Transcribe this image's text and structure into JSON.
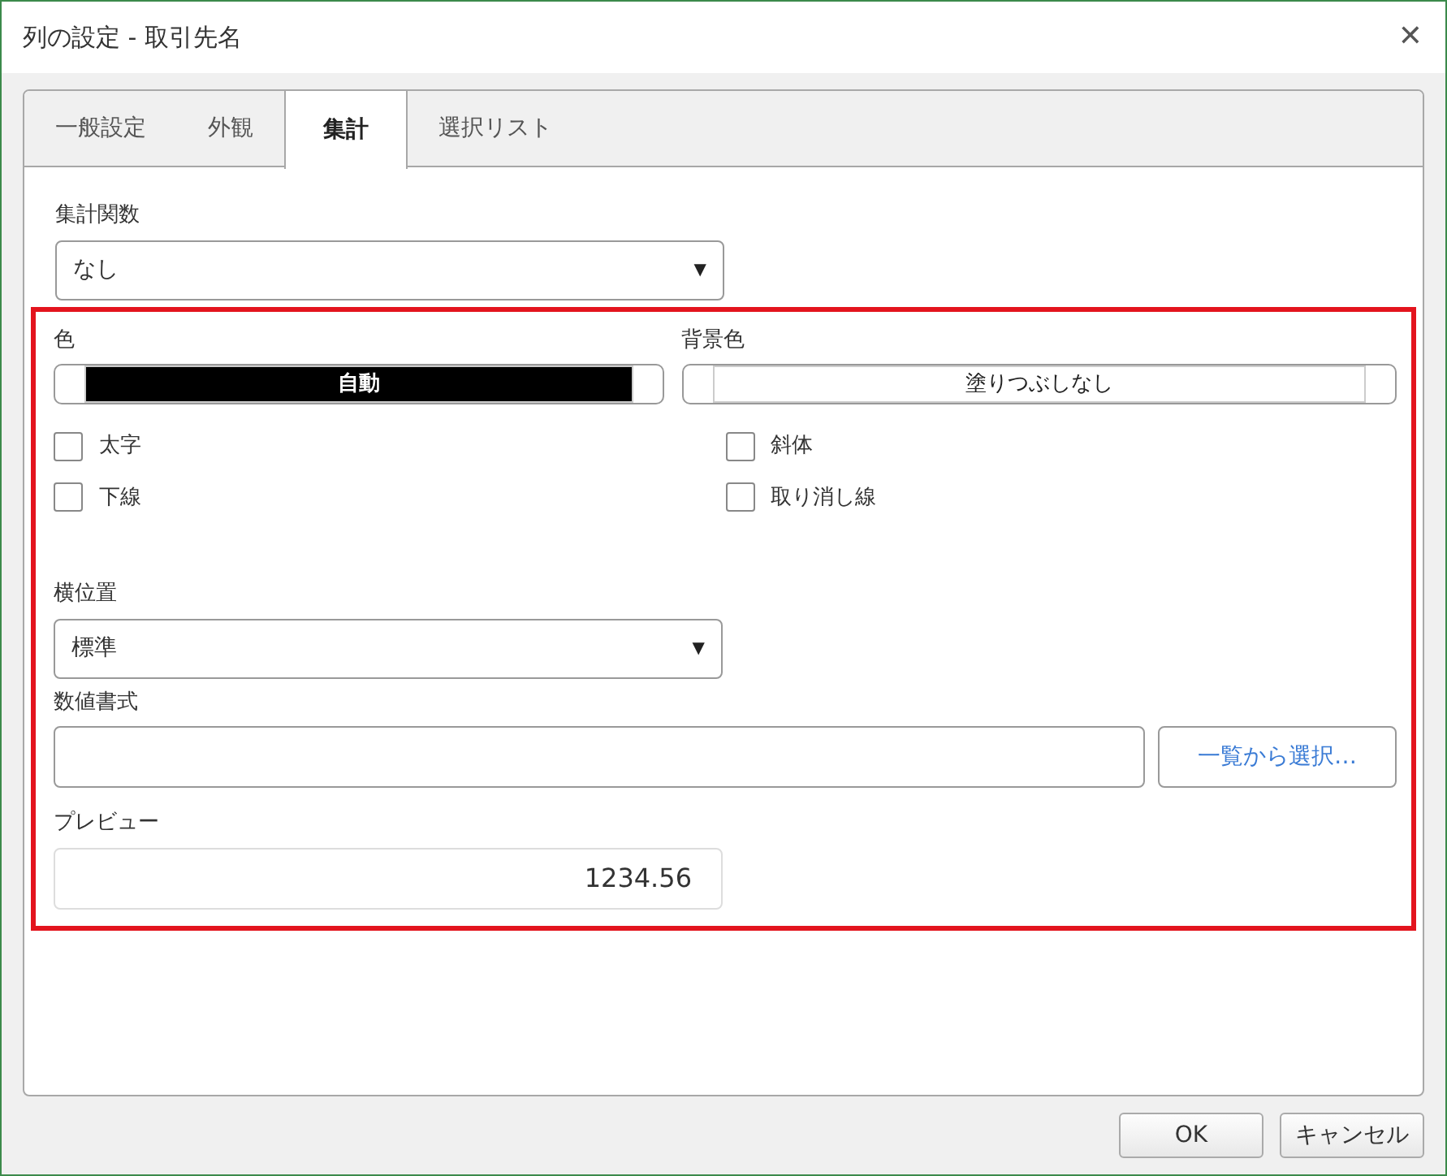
{
  "window": {
    "title": "列の設定 - 取引先名",
    "close": "✕"
  },
  "tabs": [
    {
      "label": "一般設定",
      "selected": false
    },
    {
      "label": "外観",
      "selected": false
    },
    {
      "label": "集計",
      "selected": true
    },
    {
      "label": "選択リスト",
      "selected": false
    }
  ],
  "aggregate": {
    "label": "集計関数",
    "value": "なし",
    "arrow": "▼"
  },
  "colors": [
    {
      "label": "色",
      "value": "自動",
      "color": "#000000"
    },
    {
      "label": "背景色",
      "value": "塗りつぶしなし",
      "color": "#ffffff"
    }
  ],
  "styles": [
    {
      "label": "太字",
      "checked": false
    },
    {
      "label": "斜体",
      "checked": false
    },
    {
      "label": "下線",
      "checked": false
    },
    {
      "label": "取り消し線",
      "checked": false
    }
  ],
  "alignment": {
    "label": "横位置",
    "value": "標準",
    "arrow": "▼"
  },
  "number_format": {
    "label": "数値書式",
    "button": "一覧から選択…"
  },
  "preview": {
    "label": "プレビュー",
    "value": "1234.56"
  },
  "buttons": [
    "OK",
    "キャンセル"
  ]
}
